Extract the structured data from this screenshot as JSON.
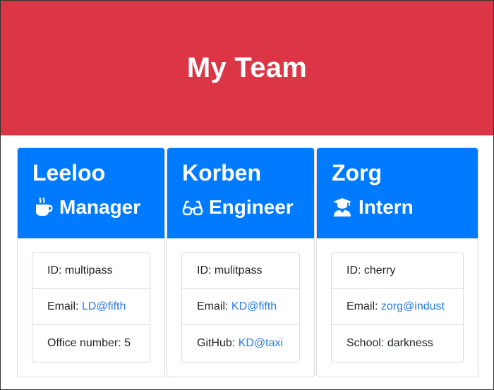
{
  "header": {
    "title": "My Team"
  },
  "colors": {
    "header_bg": "#dc3545",
    "card_head_bg": "#007bff",
    "link": "#2a7de1"
  },
  "team": [
    {
      "name": "Leeloo",
      "role": "Manager",
      "role_icon": "coffee-mug-icon",
      "id_text": "ID: multipass",
      "email_label": "Email: ",
      "email": "LD@fifth",
      "extra_label": "Office number: 5",
      "extra_link": ""
    },
    {
      "name": "Korben",
      "role": "Engineer",
      "role_icon": "glasses-icon",
      "id_text": "ID: mulitpass",
      "email_label": "Email: ",
      "email": "KD@fifth",
      "extra_label": "GitHub: ",
      "extra_link": "KD@taxi"
    },
    {
      "name": "Zorg",
      "role": "Intern",
      "role_icon": "graduate-icon",
      "id_text": "ID: cherry",
      "email_label": "Email: ",
      "email": "zorg@indust",
      "extra_label": "School: darkness",
      "extra_link": ""
    }
  ]
}
